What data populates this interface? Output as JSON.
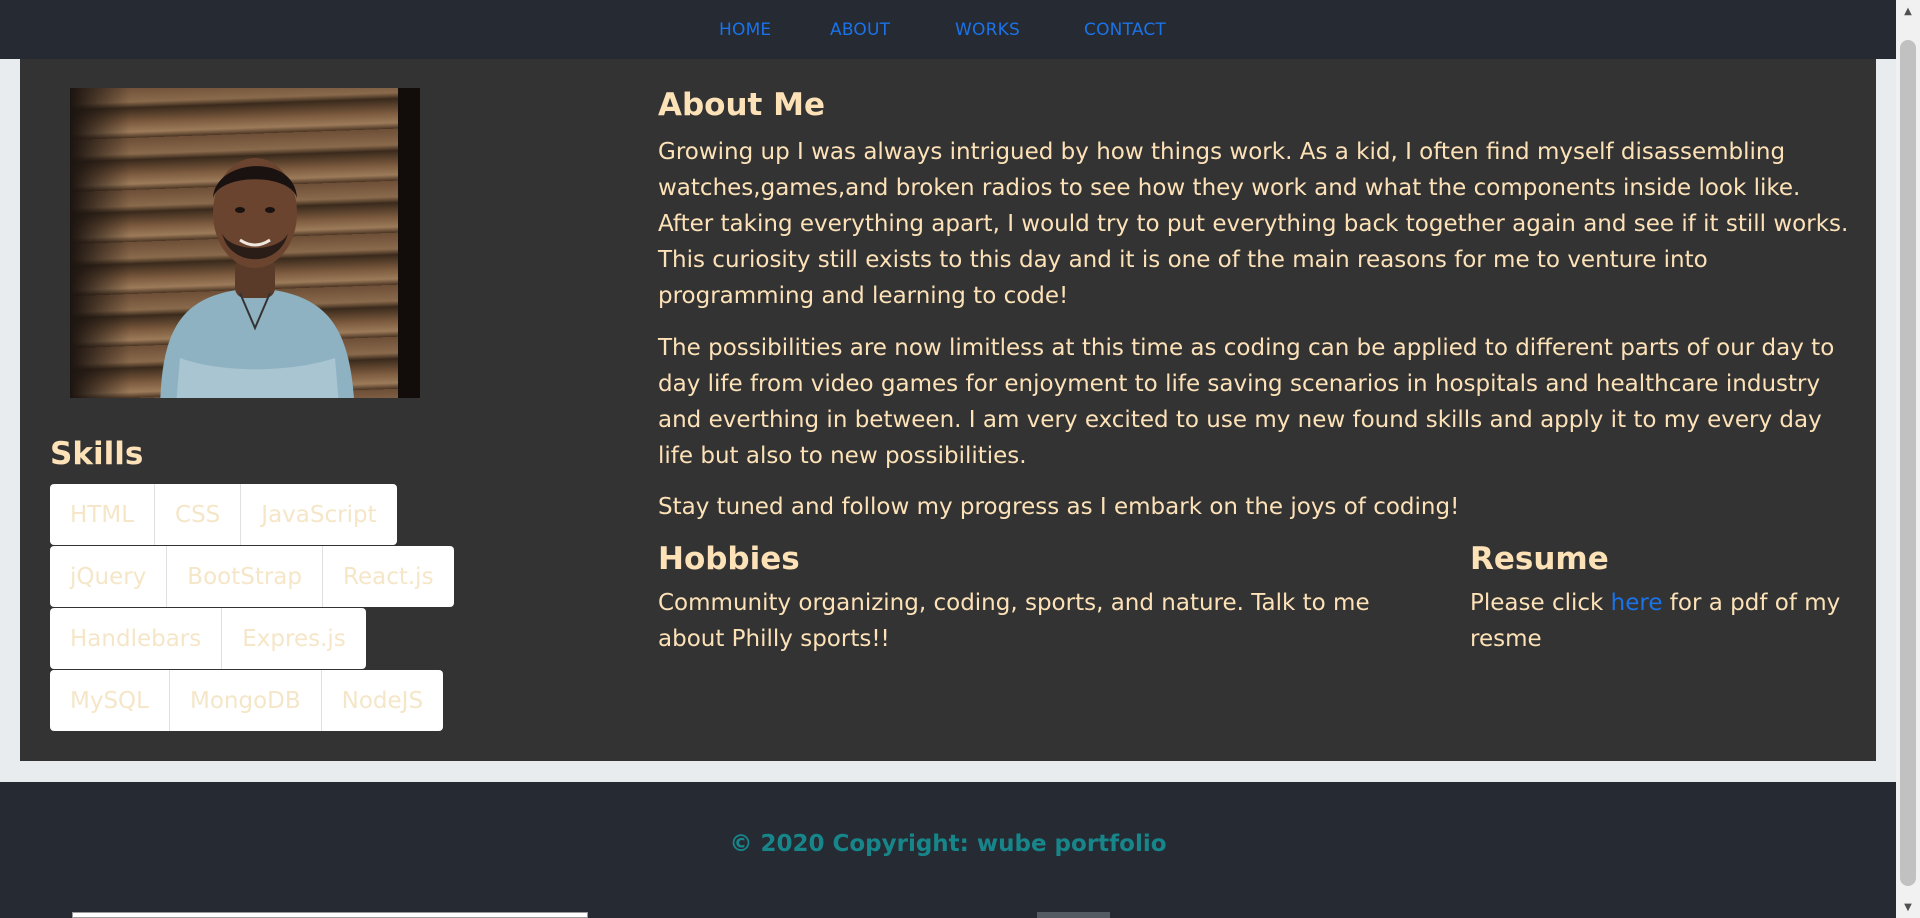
{
  "nav": {
    "home": "HOME",
    "about": "ABOUT",
    "works": "WORKS",
    "contact": "CONTACT"
  },
  "profile": {
    "photo_icon": "profile-photo"
  },
  "skills": {
    "title": "Skills",
    "rows": [
      [
        "HTML",
        "CSS",
        "JavaScript"
      ],
      [
        "jQuery",
        "BootStrap",
        "React.js"
      ],
      [
        "Handlebars",
        "Expres.js"
      ],
      [
        "MySQL",
        "MongoDB",
        "NodeJS"
      ]
    ]
  },
  "about": {
    "title": "About Me",
    "paragraphs": [
      "Growing up I was always intrigued by how things work. As a kid, I often find myself disassembling watches,games,and broken radios to see how they work and what the components inside look like. After taking everything apart, I would try to put everything back together again and see if it still works. This curiosity still exists to this day and it is one of the main reasons for me to venture into programming and learning to code!",
      "The possibilities are now limitless at this time as coding can be applied to different parts of our day to day life from video games for enjoyment to life saving scenarios in hospitals and healthcare industry and everthing in between. I am very excited to use my new found skills and apply it to my every day life but also to new possibilities.",
      "Stay tuned and follow my progress as I embark on the joys of coding!"
    ]
  },
  "hobbies": {
    "title": "Hobbies",
    "text": "Community organizing, coding, sports, and nature. Talk to me about Philly sports!!"
  },
  "resume": {
    "title": "Resume",
    "text_before": "Please click ",
    "link_label": "here",
    "text_after": " for a pdf of my resme"
  },
  "footer": {
    "copyright": "© 2020 Copyright: wube portfolio"
  },
  "colors": {
    "nav_bg": "#252a33",
    "panel_bg": "#333333",
    "text": "#fde2b8",
    "link": "#1a73e8",
    "footer_text": "#17868a"
  }
}
